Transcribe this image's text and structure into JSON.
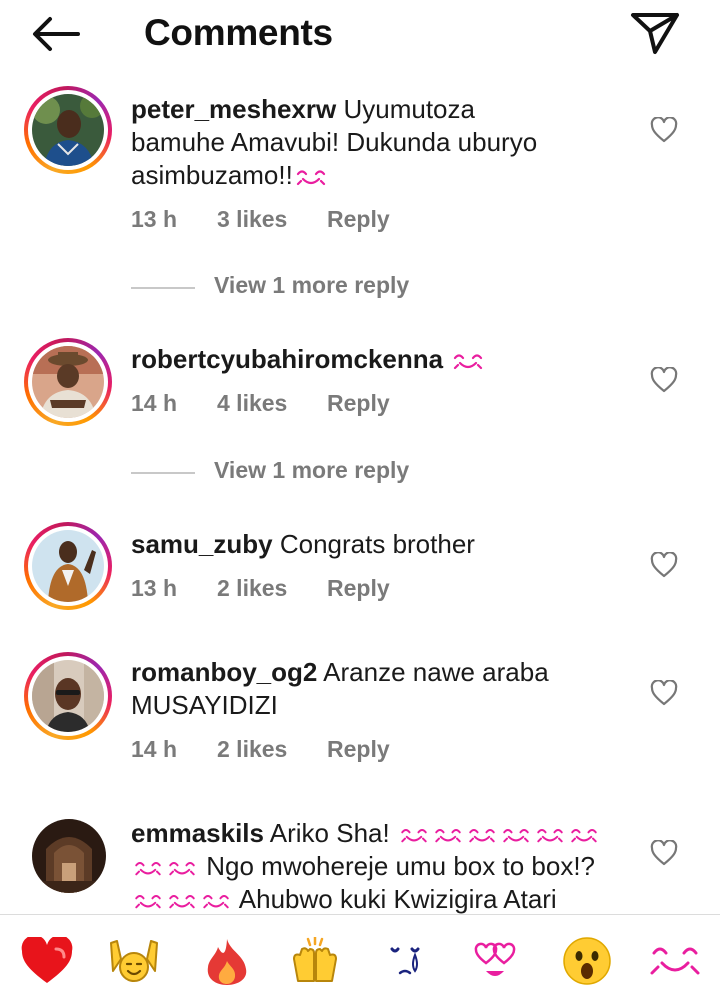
{
  "header": {
    "title": "Comments",
    "back_icon": "arrow-left-icon",
    "send_icon": "paper-plane-icon"
  },
  "comments": [
    {
      "username": "peter_meshexrw",
      "text_lines": [
        "Uyumutoza",
        "bamuhe Amavubi! Dukunda uburyo",
        "asimbuzamo!!"
      ],
      "time": "13 h",
      "likes": "3 likes",
      "reply": "Reply",
      "more_replies": "View 1 more reply"
    },
    {
      "username": "robertcyubahiromckenna",
      "text_lines": [
        ""
      ],
      "time": "14 h",
      "likes": "4 likes",
      "reply": "Reply",
      "more_replies": "View 1 more reply"
    },
    {
      "username": "samu_zuby",
      "text_lines": [
        "Congrats brother"
      ],
      "time": "13 h",
      "likes": "2 likes",
      "reply": "Reply"
    },
    {
      "username": "romanboy_og2",
      "text_lines": [
        "Aranze nawe araba",
        "MUSAYIDIZI"
      ],
      "time": "14 h",
      "likes": "2 likes",
      "reply": "Reply"
    },
    {
      "username": "emmaskils",
      "text_lines": [
        "Ariko Sha!",
        "Ngo mwohereje umu box to box!?",
        "Ahubwo kuki Kwizigira Atari"
      ]
    }
  ],
  "emoji_bar": [
    "red-heart",
    "raising-hands",
    "fire",
    "clapping-hands",
    "crying-face",
    "heart-eyes",
    "astonished-face",
    "smiling-face-with-hearts"
  ],
  "colors": {
    "accent_pink": "#e91e63",
    "muted_text": "#7a7a7a",
    "heart_red": "#e8141b"
  }
}
